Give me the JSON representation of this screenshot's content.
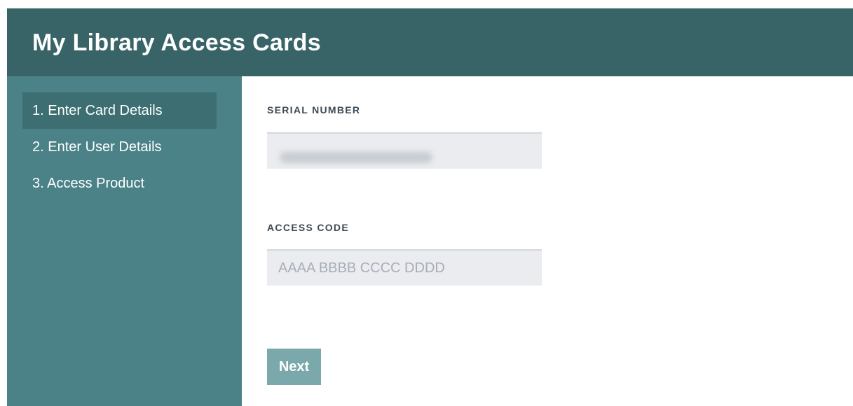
{
  "header": {
    "title": "My Library Access Cards"
  },
  "sidebar": {
    "steps": [
      {
        "label": "1. Enter Card Details",
        "active": true
      },
      {
        "label": "2. Enter User Details",
        "active": false
      },
      {
        "label": "3. Access Product",
        "active": false
      }
    ]
  },
  "form": {
    "serial_number": {
      "label": "SERIAL NUMBER",
      "value": ""
    },
    "access_code": {
      "label": "ACCESS CODE",
      "placeholder": "AAAA BBBB CCCC DDDD",
      "value": ""
    },
    "next_label": "Next"
  },
  "colors": {
    "header_bg": "#386468",
    "sidebar_bg": "#4b8287",
    "sidebar_active_bg": "#3d6e72",
    "input_bg": "#ebecef",
    "button_bg": "#7aa8ab"
  }
}
